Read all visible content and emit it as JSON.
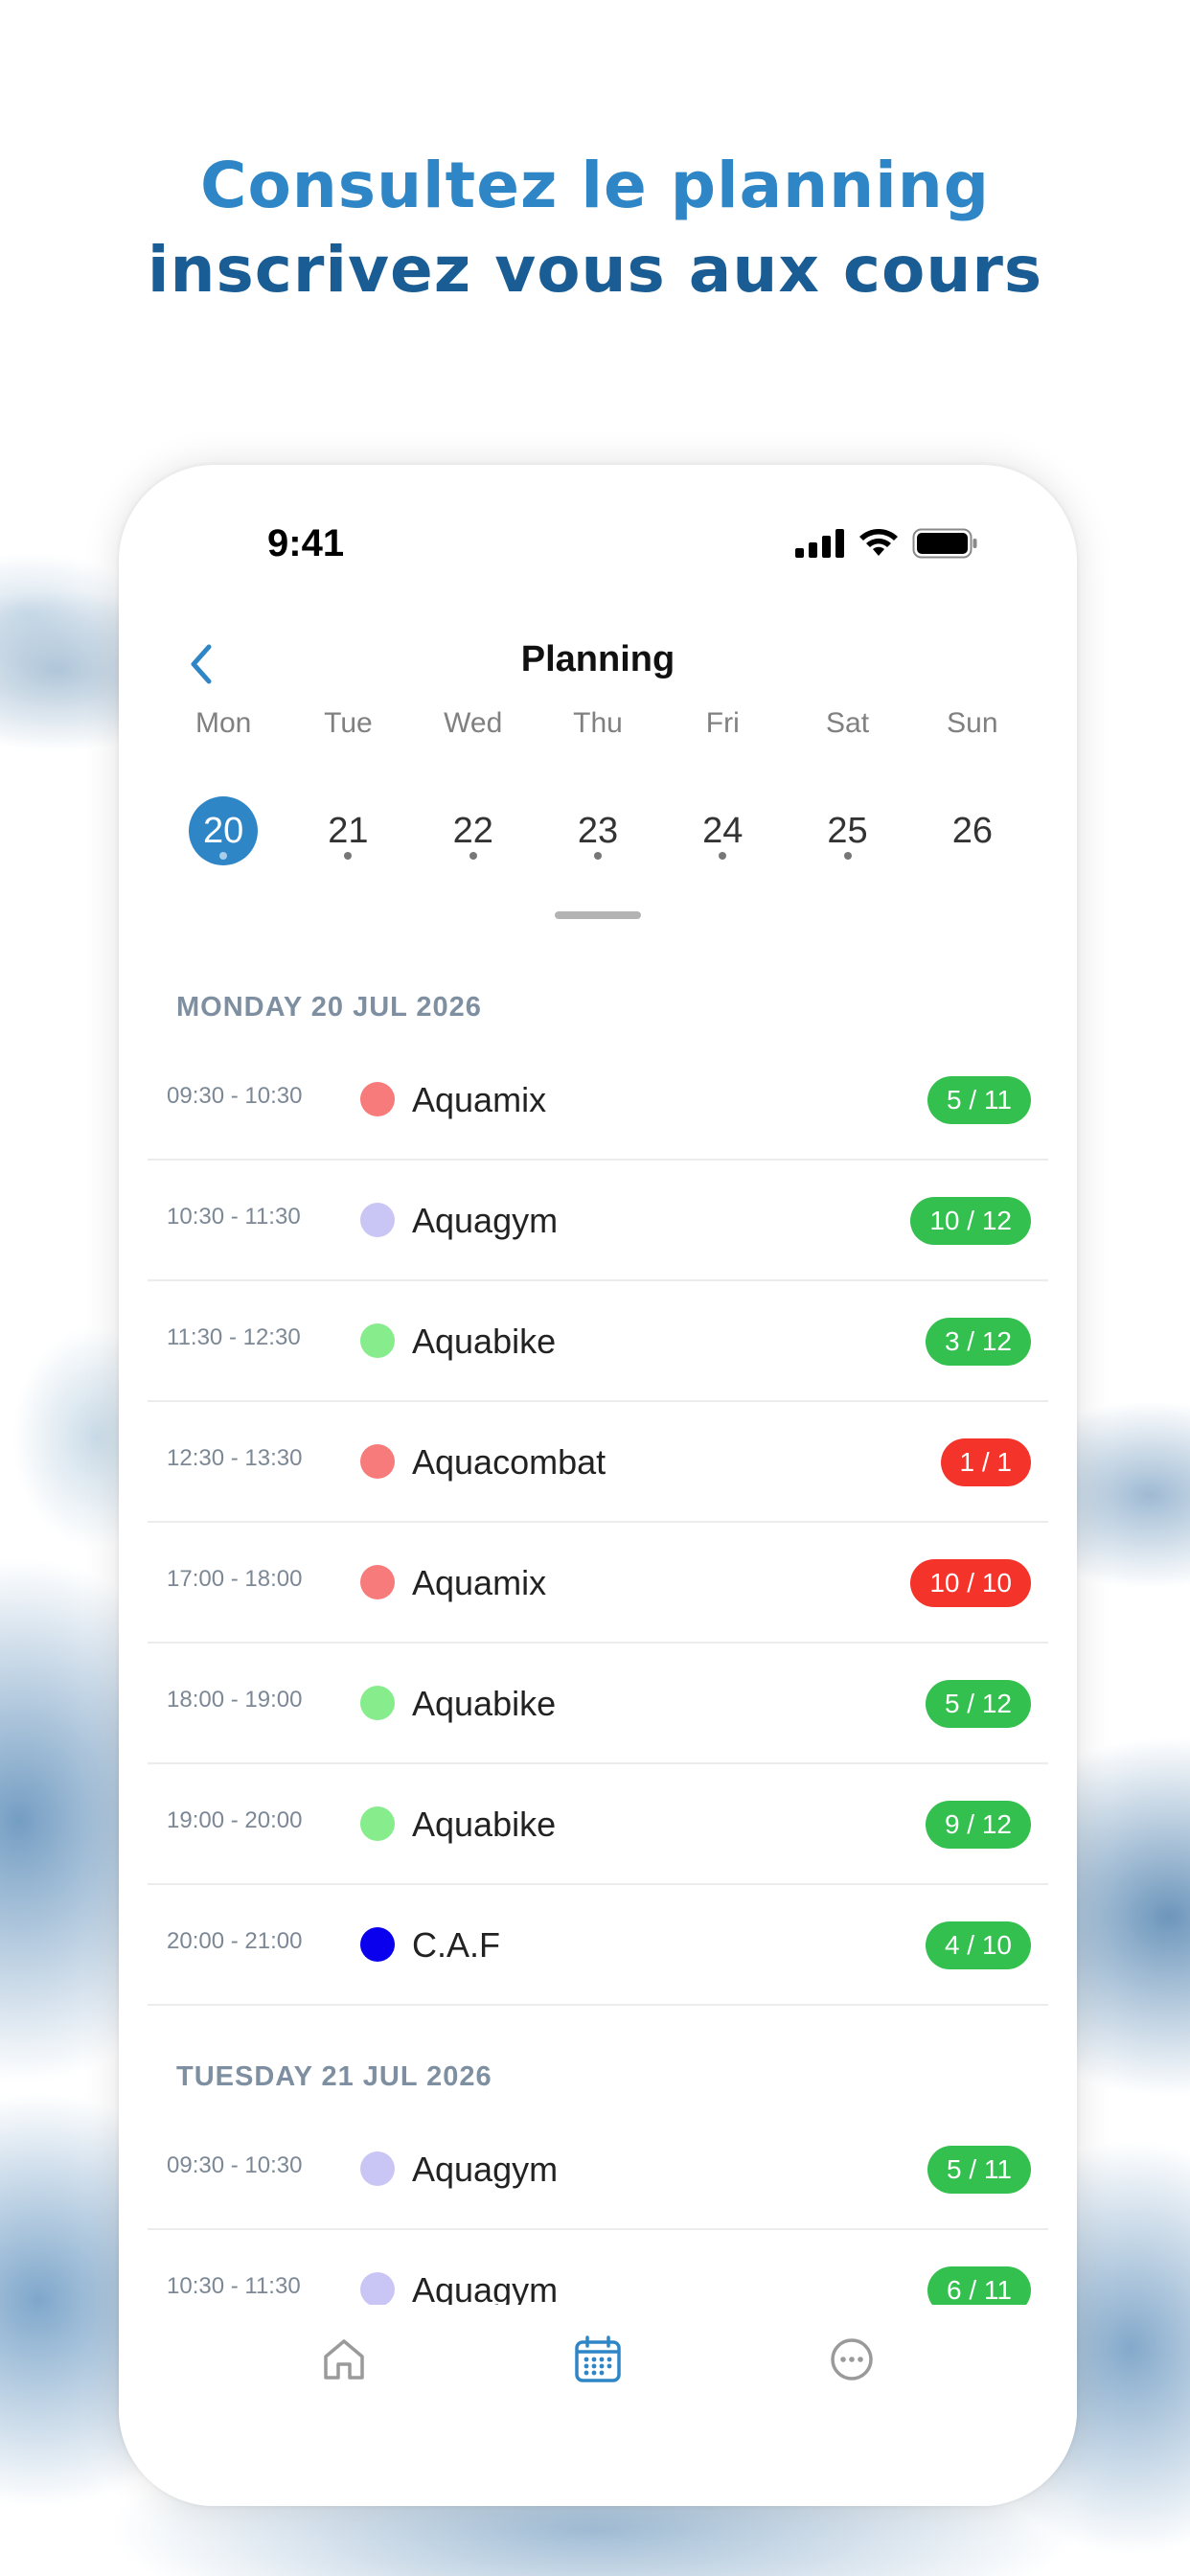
{
  "headline": {
    "line1": "Consultez le planning",
    "line2": "inscrivez vous aux cours",
    "colors": {
      "line1": "#2f86c6",
      "line2": "#1a5d95"
    }
  },
  "status_bar": {
    "time": "9:41",
    "icons": [
      "signal-icon",
      "wifi-icon",
      "battery-icon"
    ]
  },
  "nav": {
    "title": "Planning",
    "back_icon": "chevron-left-icon"
  },
  "week": {
    "weekdays": [
      "Mon",
      "Tue",
      "Wed",
      "Thu",
      "Fri",
      "Sat",
      "Sun"
    ],
    "days": [
      {
        "num": "20",
        "selected": true,
        "has_events": true
      },
      {
        "num": "21",
        "selected": false,
        "has_events": true
      },
      {
        "num": "22",
        "selected": false,
        "has_events": true
      },
      {
        "num": "23",
        "selected": false,
        "has_events": true
      },
      {
        "num": "24",
        "selected": false,
        "has_events": true
      },
      {
        "num": "25",
        "selected": false,
        "has_events": true
      },
      {
        "num": "26",
        "selected": false,
        "has_events": false
      }
    ],
    "accent": "#2f86c6"
  },
  "sections": [
    {
      "title": "MONDAY 20 JUL 2026",
      "classes": [
        {
          "time": "09:30 - 10:30",
          "name": "Aquamix",
          "dot": "#f77b7b",
          "slots": "5 / 11",
          "badge_color": "#33c04f"
        },
        {
          "time": "10:30 - 11:30",
          "name": "Aquagym",
          "dot": "#c9c6f5",
          "slots": "10 / 12",
          "badge_color": "#33c04f"
        },
        {
          "time": "11:30 - 12:30",
          "name": "Aquabike",
          "dot": "#86ec8c",
          "slots": "3 / 12",
          "badge_color": "#33c04f"
        },
        {
          "time": "12:30 - 13:30",
          "name": "Aquacombat",
          "dot": "#f77b7b",
          "slots": "1 / 1",
          "badge_color": "#f4332b"
        },
        {
          "time": "17:00 - 18:00",
          "name": "Aquamix",
          "dot": "#f77b7b",
          "slots": "10 / 10",
          "badge_color": "#f4332b"
        },
        {
          "time": "18:00 - 19:00",
          "name": "Aquabike",
          "dot": "#86ec8c",
          "slots": "5 / 12",
          "badge_color": "#33c04f"
        },
        {
          "time": "19:00 - 20:00",
          "name": "Aquabike",
          "dot": "#86ec8c",
          "slots": "9 / 12",
          "badge_color": "#33c04f"
        },
        {
          "time": "20:00 - 21:00",
          "name": "C.A.F",
          "dot": "#0a00ee",
          "slots": "4 / 10",
          "badge_color": "#33c04f"
        }
      ]
    },
    {
      "title": "TUESDAY 21 JUL 2026",
      "classes": [
        {
          "time": "09:30 - 10:30",
          "name": "Aquagym",
          "dot": "#c9c6f5",
          "slots": "5 / 11",
          "badge_color": "#33c04f"
        },
        {
          "time": "10:30 - 11:30",
          "name": "Aquagym",
          "dot": "#c9c6f5",
          "slots": "6 / 11",
          "badge_color": "#33c04f"
        }
      ]
    }
  ],
  "tabbar": {
    "tabs": [
      {
        "icon": "home-icon",
        "active": false
      },
      {
        "icon": "calendar-icon",
        "active": true
      },
      {
        "icon": "more-icon",
        "active": false
      }
    ],
    "active_color": "#2f86c6",
    "inactive_color": "#9a9a9a"
  }
}
